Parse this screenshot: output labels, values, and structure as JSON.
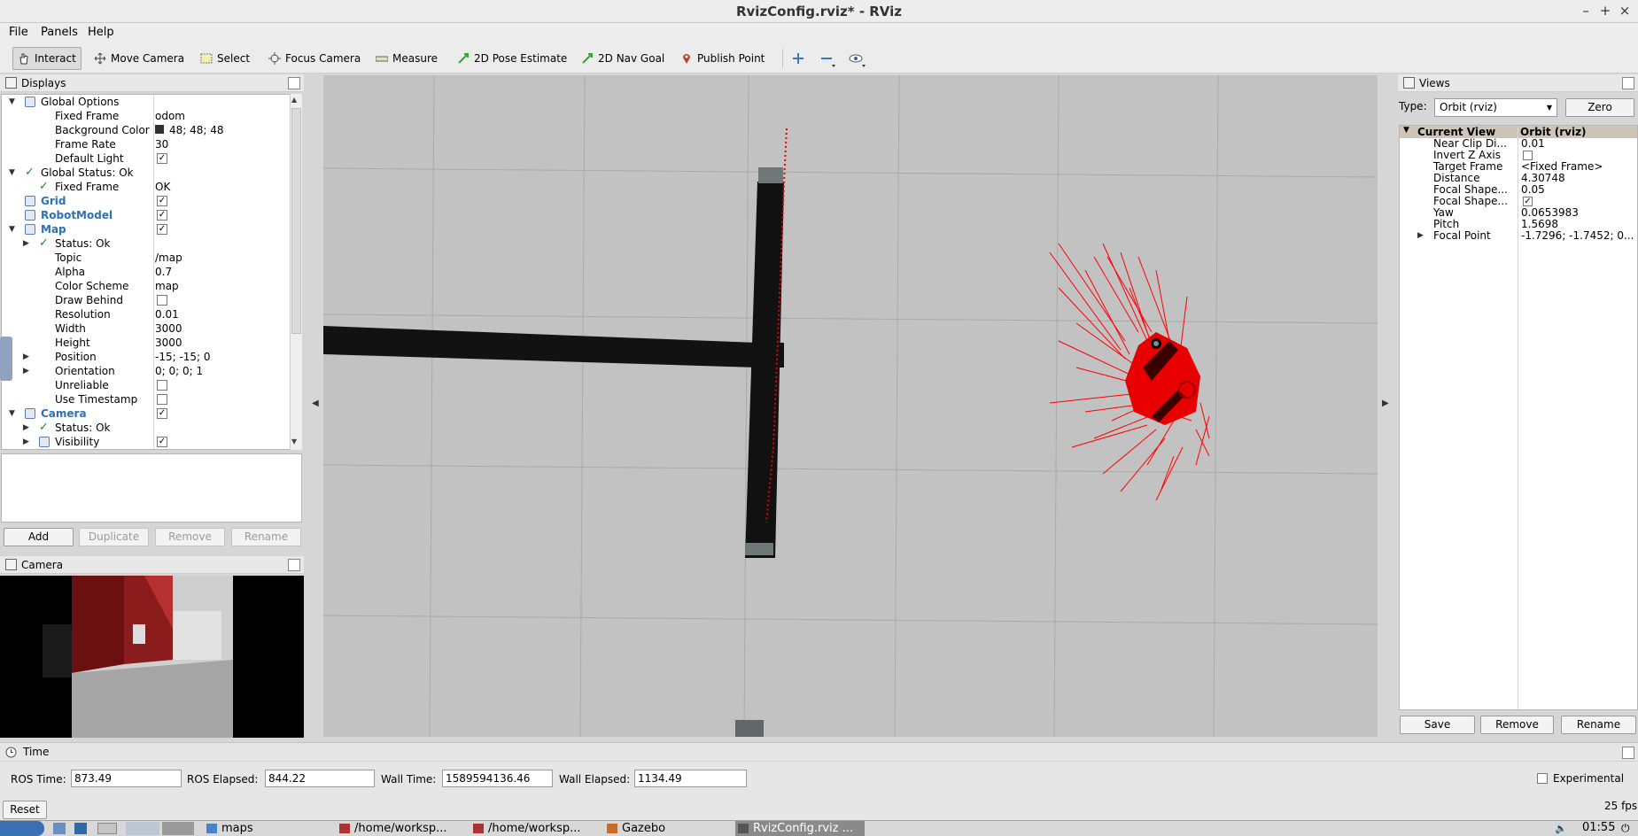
{
  "window": {
    "title": "RvizConfig.rviz* - RViz",
    "controls": {
      "minimize": "–",
      "maximize": "+",
      "close": "×"
    }
  },
  "menu": [
    "File",
    "Panels",
    "Help"
  ],
  "toolbar": {
    "tools": [
      {
        "label": "Interact",
        "icon": "hand-icon",
        "active": true
      },
      {
        "label": "Move Camera",
        "icon": "move-camera-icon"
      },
      {
        "label": "Select",
        "icon": "select-icon"
      },
      {
        "label": "Focus Camera",
        "icon": "focus-camera-icon"
      },
      {
        "label": "Measure",
        "icon": "ruler-icon"
      },
      {
        "label": "2D Pose Estimate",
        "icon": "green-arrow-icon"
      },
      {
        "label": "2D Nav Goal",
        "icon": "green-arrow-icon"
      },
      {
        "label": "Publish Point",
        "icon": "map-pin-icon"
      }
    ],
    "extra_icons": [
      "plus-icon",
      "minus-icon",
      "eye-icon"
    ]
  },
  "displays": {
    "title": "Displays",
    "rows": [
      {
        "label": "Global Options",
        "expanded": true,
        "icon": "gear-icon"
      },
      {
        "label": "Fixed Frame",
        "value": "odom"
      },
      {
        "label": "Background Color",
        "value": "48; 48; 48",
        "swatch": "#303030"
      },
      {
        "label": "Frame Rate",
        "value": "30"
      },
      {
        "label": "Default Light",
        "checked": true
      },
      {
        "label": "Global Status: Ok",
        "expanded": true,
        "status": "ok"
      },
      {
        "label": "Fixed Frame",
        "value": "OK",
        "status": "ok"
      },
      {
        "label": "Grid",
        "checked": true,
        "link": true,
        "icon": "grid-icon"
      },
      {
        "label": "RobotModel",
        "checked": true,
        "link": true,
        "icon": "robot-icon"
      },
      {
        "label": "Map",
        "checked": true,
        "link": true,
        "expanded": true,
        "icon": "map-icon"
      },
      {
        "label": "Status: Ok",
        "status": "ok",
        "collapsed": true
      },
      {
        "label": "Topic",
        "value": "/map"
      },
      {
        "label": "Alpha",
        "value": "0.7"
      },
      {
        "label": "Color Scheme",
        "value": "map"
      },
      {
        "label": "Draw Behind",
        "checked": false
      },
      {
        "label": "Resolution",
        "value": "0.01"
      },
      {
        "label": "Width",
        "value": "3000"
      },
      {
        "label": "Height",
        "value": "3000"
      },
      {
        "label": "Position",
        "value": "-15; -15; 0",
        "collapsed": true
      },
      {
        "label": "Orientation",
        "value": "0; 0; 0; 1",
        "collapsed": true
      },
      {
        "label": "Unreliable",
        "checked": false
      },
      {
        "label": "Use Timestamp",
        "checked": false
      },
      {
        "label": "Camera",
        "checked": true,
        "link": true,
        "expanded": true,
        "icon": "camera-icon"
      },
      {
        "label": "Status: Ok",
        "status": "ok",
        "collapsed": true
      },
      {
        "label": "Visibility",
        "checked": true,
        "collapsed": true,
        "icon": "eye-icon"
      }
    ],
    "buttons": {
      "add": "Add",
      "duplicate": "Duplicate",
      "remove": "Remove",
      "rename": "Rename"
    }
  },
  "camera_panel": {
    "title": "Camera"
  },
  "views": {
    "title": "Views",
    "type_label": "Type:",
    "type_value": "Orbit (rviz)",
    "zero_label": "Zero",
    "header": {
      "label": "Current View",
      "value": "Orbit (rviz)"
    },
    "rows": [
      {
        "label": "Near Clip Di...",
        "value": "0.01"
      },
      {
        "label": "Invert Z Axis",
        "checked": false
      },
      {
        "label": "Target Frame",
        "value": "<Fixed Frame>"
      },
      {
        "label": "Distance",
        "value": "4.30748"
      },
      {
        "label": "Focal Shape...",
        "value": "0.05"
      },
      {
        "label": "Focal Shape...",
        "checked": true
      },
      {
        "label": "Yaw",
        "value": "0.0653983"
      },
      {
        "label": "Pitch",
        "value": "1.5698"
      },
      {
        "label": "Focal Point",
        "value": "-1.7296; -1.7452; 0...",
        "collapsed": true
      }
    ],
    "buttons": {
      "save": "Save",
      "remove": "Remove",
      "rename": "Rename"
    }
  },
  "time": {
    "title": "Time",
    "ros_time_label": "ROS Time:",
    "ros_time": "873.49",
    "ros_elapsed_label": "ROS Elapsed:",
    "ros_elapsed": "844.22",
    "wall_time_label": "Wall Time:",
    "wall_time": "1589594136.46",
    "wall_elapsed_label": "Wall Elapsed:",
    "wall_elapsed": "1134.49",
    "experimental_label": "Experimental",
    "reset_label": "Reset",
    "fps": "25 fps"
  },
  "taskbar": {
    "items": [
      "maps",
      "/home/worksp...",
      "/home/worksp...",
      "Gazebo",
      "RvizConfig.rviz ..."
    ],
    "clock": "01:55"
  }
}
